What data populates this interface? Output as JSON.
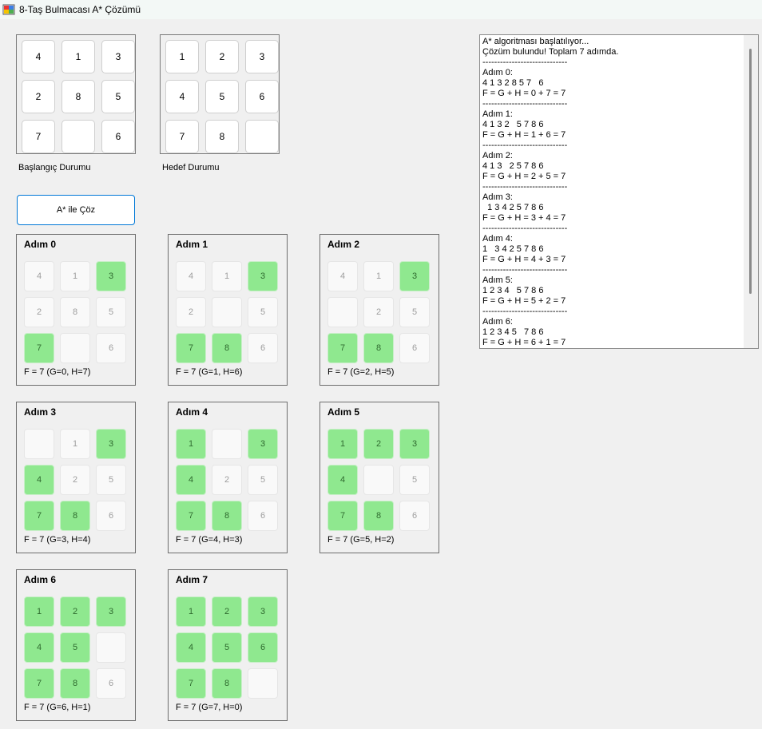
{
  "window": {
    "title": "8-Taş Bulmacası A* Çözümü"
  },
  "start_board": {
    "caption": "Başlangıç Durumu",
    "tiles": [
      "4",
      "1",
      "3",
      "2",
      "8",
      "5",
      "7",
      "",
      "6"
    ]
  },
  "goal_board": {
    "caption": "Hedef Durumu",
    "tiles": [
      "1",
      "2",
      "3",
      "4",
      "5",
      "6",
      "7",
      "8",
      ""
    ]
  },
  "solve_button": {
    "label": "A* ile Çöz"
  },
  "steps": [
    {
      "title": "Adım 0",
      "info": "F = 7 (G=0, H=7)",
      "cells": [
        {
          "v": "4",
          "s": "gray"
        },
        {
          "v": "1",
          "s": "gray"
        },
        {
          "v": "3",
          "s": "green"
        },
        {
          "v": "2",
          "s": "gray"
        },
        {
          "v": "8",
          "s": "gray"
        },
        {
          "v": "5",
          "s": "gray"
        },
        {
          "v": "7",
          "s": "green"
        },
        {
          "v": "",
          "s": "empty"
        },
        {
          "v": "6",
          "s": "gray"
        }
      ]
    },
    {
      "title": "Adım 1",
      "info": "F = 7 (G=1, H=6)",
      "cells": [
        {
          "v": "4",
          "s": "gray"
        },
        {
          "v": "1",
          "s": "gray"
        },
        {
          "v": "3",
          "s": "green"
        },
        {
          "v": "2",
          "s": "gray"
        },
        {
          "v": "",
          "s": "empty"
        },
        {
          "v": "5",
          "s": "gray"
        },
        {
          "v": "7",
          "s": "green"
        },
        {
          "v": "8",
          "s": "green"
        },
        {
          "v": "6",
          "s": "gray"
        }
      ]
    },
    {
      "title": "Adım 2",
      "info": "F = 7 (G=2, H=5)",
      "cells": [
        {
          "v": "4",
          "s": "gray"
        },
        {
          "v": "1",
          "s": "gray"
        },
        {
          "v": "3",
          "s": "green"
        },
        {
          "v": "",
          "s": "empty"
        },
        {
          "v": "2",
          "s": "gray"
        },
        {
          "v": "5",
          "s": "gray"
        },
        {
          "v": "7",
          "s": "green"
        },
        {
          "v": "8",
          "s": "green"
        },
        {
          "v": "6",
          "s": "gray"
        }
      ]
    },
    {
      "title": "Adım 3",
      "info": "F = 7 (G=3, H=4)",
      "cells": [
        {
          "v": "",
          "s": "empty"
        },
        {
          "v": "1",
          "s": "gray"
        },
        {
          "v": "3",
          "s": "green"
        },
        {
          "v": "4",
          "s": "green"
        },
        {
          "v": "2",
          "s": "gray"
        },
        {
          "v": "5",
          "s": "gray"
        },
        {
          "v": "7",
          "s": "green"
        },
        {
          "v": "8",
          "s": "green"
        },
        {
          "v": "6",
          "s": "gray"
        }
      ]
    },
    {
      "title": "Adım 4",
      "info": "F = 7 (G=4, H=3)",
      "cells": [
        {
          "v": "1",
          "s": "green"
        },
        {
          "v": "",
          "s": "empty"
        },
        {
          "v": "3",
          "s": "green"
        },
        {
          "v": "4",
          "s": "green"
        },
        {
          "v": "2",
          "s": "gray"
        },
        {
          "v": "5",
          "s": "gray"
        },
        {
          "v": "7",
          "s": "green"
        },
        {
          "v": "8",
          "s": "green"
        },
        {
          "v": "6",
          "s": "gray"
        }
      ]
    },
    {
      "title": "Adım 5",
      "info": "F = 7 (G=5, H=2)",
      "cells": [
        {
          "v": "1",
          "s": "green"
        },
        {
          "v": "2",
          "s": "green"
        },
        {
          "v": "3",
          "s": "green"
        },
        {
          "v": "4",
          "s": "green"
        },
        {
          "v": "",
          "s": "empty"
        },
        {
          "v": "5",
          "s": "gray"
        },
        {
          "v": "7",
          "s": "green"
        },
        {
          "v": "8",
          "s": "green"
        },
        {
          "v": "6",
          "s": "gray"
        }
      ]
    },
    {
      "title": "Adım 6",
      "info": "F = 7 (G=6, H=1)",
      "cells": [
        {
          "v": "1",
          "s": "green"
        },
        {
          "v": "2",
          "s": "green"
        },
        {
          "v": "3",
          "s": "green"
        },
        {
          "v": "4",
          "s": "green"
        },
        {
          "v": "5",
          "s": "green"
        },
        {
          "v": "",
          "s": "empty"
        },
        {
          "v": "7",
          "s": "green"
        },
        {
          "v": "8",
          "s": "green"
        },
        {
          "v": "6",
          "s": "gray"
        }
      ]
    },
    {
      "title": "Adım 7",
      "info": "F = 7 (G=7, H=0)",
      "cells": [
        {
          "v": "1",
          "s": "green"
        },
        {
          "v": "2",
          "s": "green"
        },
        {
          "v": "3",
          "s": "green"
        },
        {
          "v": "4",
          "s": "green"
        },
        {
          "v": "5",
          "s": "green"
        },
        {
          "v": "6",
          "s": "green"
        },
        {
          "v": "7",
          "s": "green"
        },
        {
          "v": "8",
          "s": "green"
        },
        {
          "v": "",
          "s": "empty"
        }
      ]
    }
  ],
  "log": {
    "lines": [
      "A* algoritması başlatılıyor...",
      "Çözüm bulundu! Toplam 7 adımda.",
      "-----------------------------",
      "Adım 0:",
      "4 1 3 2 8 5 7   6",
      "F = G + H = 0 + 7 = 7",
      "-----------------------------",
      "Adım 1:",
      "4 1 3 2   5 7 8 6",
      "F = G + H = 1 + 6 = 7",
      "-----------------------------",
      "Adım 2:",
      "4 1 3   2 5 7 8 6",
      "F = G + H = 2 + 5 = 7",
      "-----------------------------",
      "Adım 3:",
      "  1 3 4 2 5 7 8 6",
      "F = G + H = 3 + 4 = 7",
      "-----------------------------",
      "Adım 4:",
      "1   3 4 2 5 7 8 6",
      "F = G + H = 4 + 3 = 7",
      "-----------------------------",
      "Adım 5:",
      "1 2 3 4   5 7 8 6",
      "F = G + H = 5 + 2 = 7",
      "-----------------------------",
      "Adım 6:",
      "1 2 3 4 5   7 8 6",
      "F = G + H = 6 + 1 = 7"
    ]
  },
  "colors": {
    "solved_tile": "#8fe88f",
    "unsolved_tile": "#f9f9f9",
    "button_border": "#0078d7"
  }
}
